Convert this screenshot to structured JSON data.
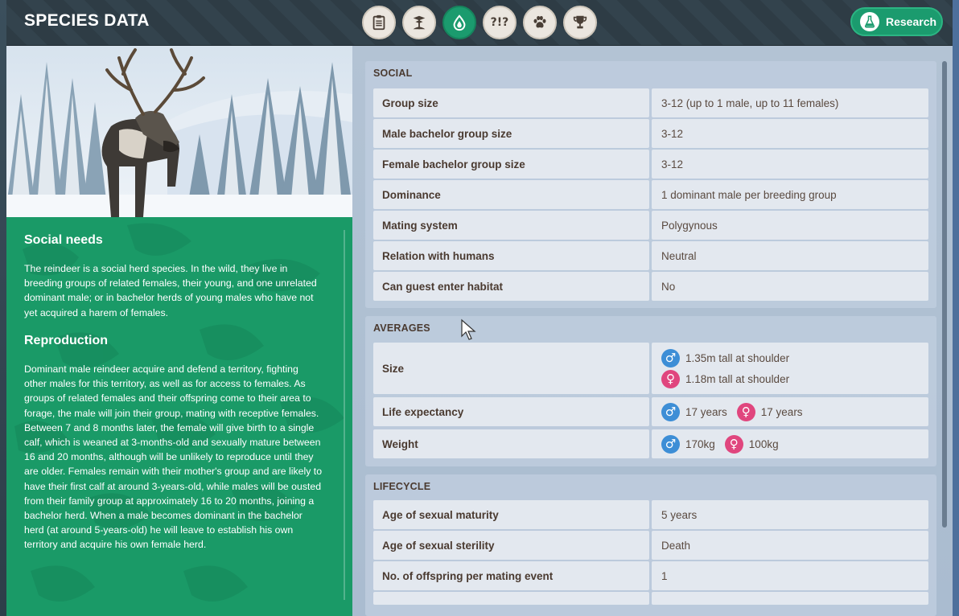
{
  "header": {
    "title": "SPECIES DATA",
    "tabs": [
      {
        "icon": "clipboard-icon",
        "label": ""
      },
      {
        "icon": "habitat-icon",
        "label": ""
      },
      {
        "icon": "water-drop-icon",
        "label": ""
      },
      {
        "icon": "trivia-icon",
        "label": "?!?"
      },
      {
        "icon": "paw-icon",
        "label": ""
      },
      {
        "icon": "trophy-icon",
        "label": ""
      }
    ],
    "active_tab": 2,
    "research_label": "Research"
  },
  "left": {
    "social_heading": "Social needs",
    "social_text": "The reindeer is a social herd species. In the wild, they live in breeding groups of related females, their young, and one unrelated dominant male; or in bachelor herds of young males who have not yet acquired a harem of females.",
    "repro_heading": "Reproduction",
    "repro_text": "Dominant male reindeer acquire and defend a territory, fighting other males for this territory, as well as for access to females. As groups of related females and their offspring come to their area to forage, the male will join their group, mating with receptive females. Between 7 and 8 months later, the female will give birth to a single calf, which is weaned at 3-months-old and sexually mature between 16 and 20 months, although will be unlikely to reproduce until they are older. Females remain with their mother's group and are likely to have their first calf at around 3-years-old, while males will be ousted from their family group at approximately 16 to 20 months, joining a bachelor herd. When a male becomes dominant in the bachelor herd (at around 5-years-old) he will leave to establish his own territory and acquire his own female herd."
  },
  "social": {
    "title": "SOCIAL",
    "rows": [
      {
        "label": "Group size",
        "value": "3-12 (up to 1 male, up to 11 females)"
      },
      {
        "label": "Male bachelor group size",
        "value": "3-12"
      },
      {
        "label": "Female bachelor group size",
        "value": "3-12"
      },
      {
        "label": "Dominance",
        "value": "1 dominant male per breeding group"
      },
      {
        "label": "Mating system",
        "value": "Polygynous"
      },
      {
        "label": "Relation with humans",
        "value": "Neutral"
      },
      {
        "label": "Can guest enter habitat",
        "value": "No"
      }
    ]
  },
  "averages": {
    "title": "AVERAGES",
    "size_label": "Size",
    "size_male": "1.35m tall at shoulder",
    "size_female": "1.18m tall at shoulder",
    "life_label": "Life expectancy",
    "life_male": "17 years",
    "life_female": "17 years",
    "weight_label": "Weight",
    "weight_male": "170kg",
    "weight_female": "100kg"
  },
  "lifecycle": {
    "title": "LIFECYCLE",
    "rows": [
      {
        "label": "Age of sexual maturity",
        "value": "5 years"
      },
      {
        "label": "Age of sexual sterility",
        "value": "Death"
      },
      {
        "label": "No. of offspring per mating event",
        "value": "1"
      }
    ]
  },
  "colors": {
    "accent": "#1b9b6e",
    "male": "#3d8ed6",
    "female": "#e0467e",
    "header": "#2e3c45"
  }
}
